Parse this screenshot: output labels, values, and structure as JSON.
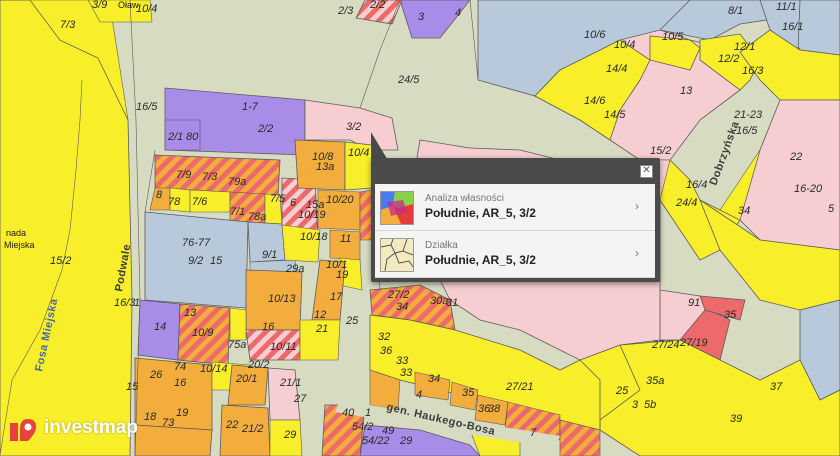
{
  "map": {
    "parcel_colors": {
      "yellow": "#f8ee2a",
      "purple": "#a98be8",
      "pink": "#f6cdd0",
      "orange": "#f2ad3c",
      "blue": "#b8c9dc",
      "red": "#ec6a6a",
      "road": "#d7dbc2"
    },
    "street_names": {
      "fosa_miejska": "Fosa Miejska",
      "podwale": "Podwale",
      "dobrzynska": "Dobrzyńska",
      "haukego": "gen. Haukego-Bosa",
      "nada": "nada",
      "miejska_left": "Miejska",
      "olaw": "Oław"
    },
    "parcel_labels": [
      "3/9",
      "10/4",
      "2/3",
      "2/2",
      "3",
      "4",
      "7/3",
      "24/5",
      "10/6",
      "8/1",
      "11/1",
      "16/1",
      "10/4",
      "10/5",
      "12/1",
      "12/2",
      "14/4",
      "16/3",
      "16/5",
      "2/2",
      "1-7",
      "3/2",
      "2/1",
      "80",
      "14/6",
      "13",
      "14/5",
      "21-23",
      "16/5",
      "22",
      "15/2",
      "16-20",
      "16/4",
      "24/4",
      "34",
      "5",
      "10/8",
      "13a",
      "10/4",
      "7/9",
      "7/3",
      "79a",
      "8",
      "78",
      "7/6",
      "7/5",
      "6",
      "15a",
      "10/20",
      "10/19",
      "7/1",
      "78a",
      "76-77",
      "9/2",
      "9/1",
      "10/18",
      "11",
      "29a",
      "10/1",
      "19",
      "10/13",
      "17",
      "12",
      "21",
      "14",
      "13",
      "10/9",
      "75a",
      "25",
      "10/11",
      "10/14",
      "74",
      "16",
      "20/2",
      "26",
      "20/1",
      "21/1",
      "27",
      "73",
      "19",
      "18",
      "22",
      "21/2",
      "29",
      "40",
      "1",
      "54/2",
      "54/22",
      "49",
      "29",
      "27/2",
      "34",
      "30a",
      "31",
      "32",
      "36",
      "33",
      "33",
      "34",
      "4",
      "35",
      "36",
      "38",
      "7",
      "27/21",
      "27/24",
      "27/19",
      "91",
      "35",
      "35a",
      "25",
      "3",
      "5b",
      "37",
      "39",
      "16/3",
      "1",
      "15/2",
      "15",
      "16",
      "15",
      "29"
    ]
  },
  "popup": {
    "close_glyph": "✕",
    "items": [
      {
        "title": "Analiza własności",
        "value": "Południe, AR_5, 3/2",
        "chevron": "›"
      },
      {
        "title": "Działka",
        "value": "Południe, AR_5, 3/2",
        "chevron": "›"
      }
    ]
  },
  "logo": {
    "text": "investmap"
  }
}
